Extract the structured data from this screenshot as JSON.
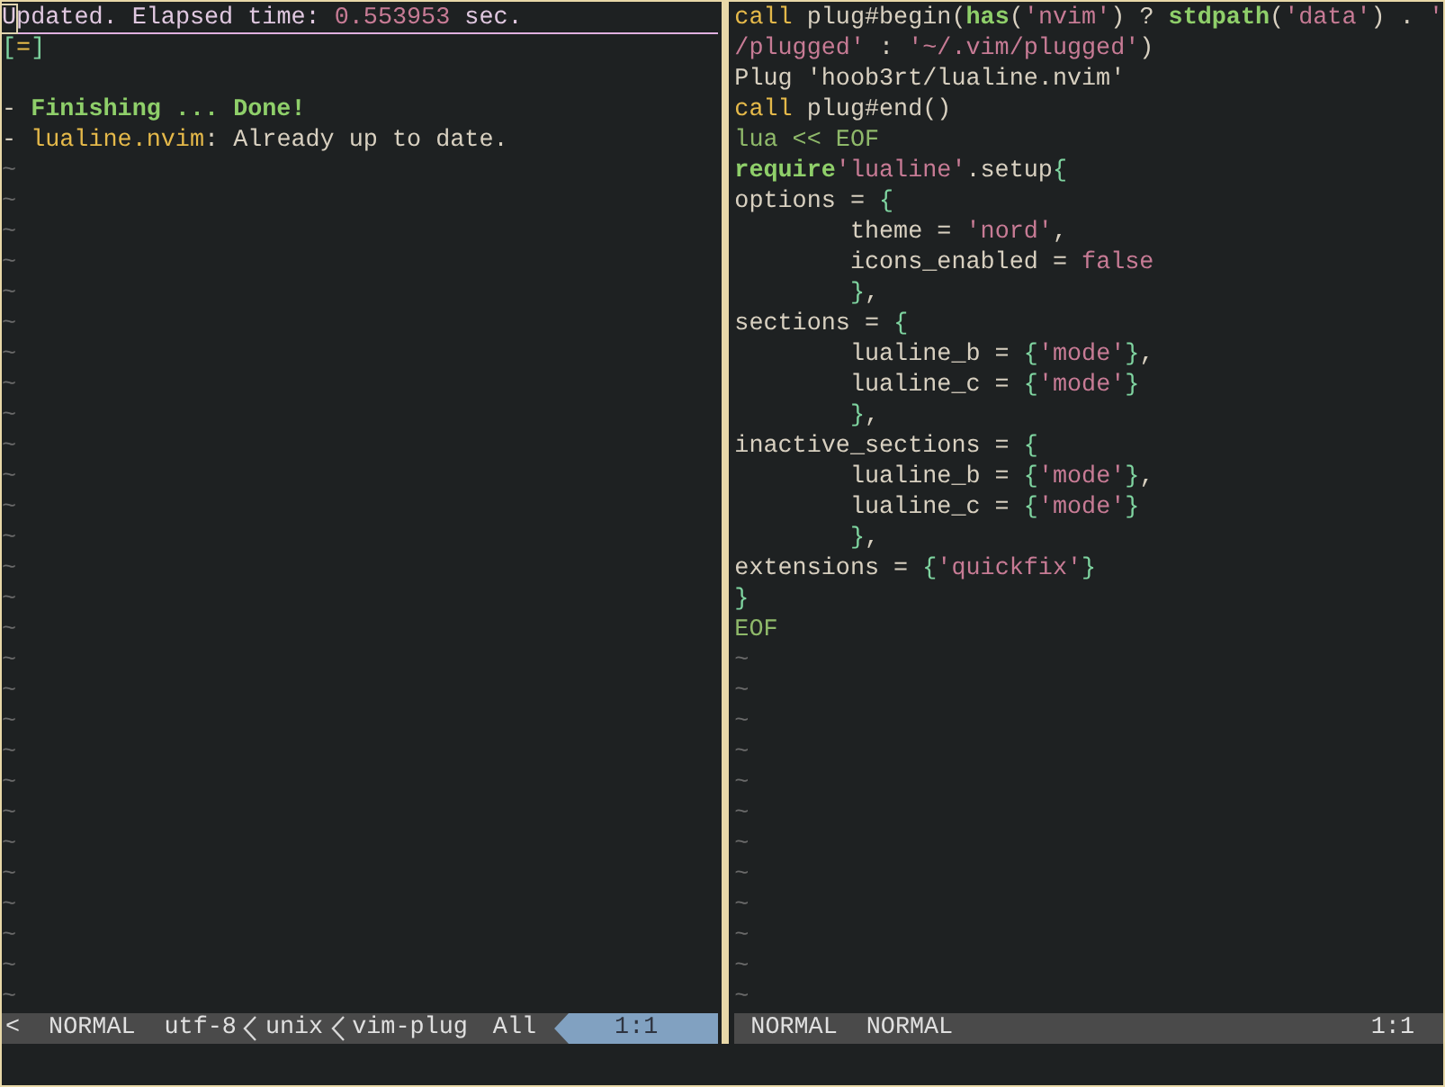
{
  "left_pane": {
    "lines": [
      {
        "tokens": [
          {
            "kind": "cursor",
            "text": "U"
          },
          {
            "kind": "message",
            "text": "pdated. Elapsed time: "
          },
          {
            "kind": "number",
            "text": "0.553953"
          },
          {
            "kind": "message",
            "text": " sec."
          }
        ]
      },
      {
        "tokens": [
          {
            "kind": "brace",
            "text": "["
          },
          {
            "kind": "keyword",
            "text": "="
          },
          {
            "kind": "brace",
            "text": "]"
          }
        ]
      },
      {
        "blank": true
      },
      {
        "tokens": [
          {
            "kind": "text",
            "text": "- "
          },
          {
            "kind": "success",
            "text": "Finishing ... Done!"
          }
        ]
      },
      {
        "tokens": [
          {
            "kind": "text",
            "text": "- "
          },
          {
            "kind": "keyword",
            "text": "lualine.nvim"
          },
          {
            "kind": "text",
            "text": ": Already up to date."
          }
        ]
      }
    ],
    "tildes": [
      "~",
      "~",
      "~",
      "~",
      "~",
      "~",
      "~",
      "~",
      "~",
      "~",
      "~",
      "~",
      "~",
      "~",
      "~",
      "~",
      "~",
      "~",
      "~",
      "~",
      "~",
      "~",
      "~",
      "~",
      "~",
      "~",
      "~",
      "~"
    ]
  },
  "right_pane": {
    "lines": [
      {
        "tokens": [
          {
            "kind": "keyword",
            "text": "call"
          },
          {
            "kind": "text",
            "text": " plug#begin("
          },
          {
            "kind": "function",
            "text": "has"
          },
          {
            "kind": "text",
            "text": "("
          },
          {
            "kind": "string",
            "text": "'nvim'"
          },
          {
            "kind": "text",
            "text": ") ? "
          },
          {
            "kind": "function",
            "text": "stdpath"
          },
          {
            "kind": "text",
            "text": "("
          },
          {
            "kind": "string",
            "text": "'data'"
          },
          {
            "kind": "text",
            "text": ") . "
          },
          {
            "kind": "string",
            "text": "'"
          }
        ]
      },
      {
        "tokens": [
          {
            "kind": "string",
            "text": "/plugged'"
          },
          {
            "kind": "text",
            "text": " : "
          },
          {
            "kind": "string",
            "text": "'~/.vim/plugged'"
          },
          {
            "kind": "text",
            "text": ")"
          }
        ]
      },
      {
        "tokens": [
          {
            "kind": "text",
            "text": "Plug 'hoob3rt/lualine.nvim'"
          }
        ]
      },
      {
        "tokens": [
          {
            "kind": "keyword",
            "text": "call"
          },
          {
            "kind": "text",
            "text": " plug#end()"
          }
        ]
      },
      {
        "tokens": [
          {
            "kind": "heredoc",
            "text": "lua << EOF"
          }
        ]
      },
      {
        "tokens": [
          {
            "kind": "function",
            "text": "require"
          },
          {
            "kind": "string",
            "text": "'lualine'"
          },
          {
            "kind": "text",
            "text": ".setup"
          },
          {
            "kind": "brace",
            "text": "{"
          }
        ]
      },
      {
        "tokens": [
          {
            "kind": "text",
            "text": "options = "
          },
          {
            "kind": "brace",
            "text": "{"
          }
        ]
      },
      {
        "indented": true,
        "tokens": [
          {
            "kind": "text",
            "text": "theme = "
          },
          {
            "kind": "string",
            "text": "'nord'"
          },
          {
            "kind": "text",
            "text": ","
          }
        ]
      },
      {
        "indented": true,
        "tokens": [
          {
            "kind": "text",
            "text": "icons_enabled = "
          },
          {
            "kind": "string",
            "text": "false"
          }
        ]
      },
      {
        "indented": true,
        "tokens": [
          {
            "kind": "brace",
            "text": "}"
          },
          {
            "kind": "text",
            "text": ","
          }
        ]
      },
      {
        "tokens": [
          {
            "kind": "text",
            "text": "sections = "
          },
          {
            "kind": "brace",
            "text": "{"
          }
        ]
      },
      {
        "indented": true,
        "tokens": [
          {
            "kind": "text",
            "text": "lualine_b = "
          },
          {
            "kind": "brace",
            "text": "{"
          },
          {
            "kind": "string",
            "text": "'mode'"
          },
          {
            "kind": "brace",
            "text": "}"
          },
          {
            "kind": "text",
            "text": ","
          }
        ]
      },
      {
        "indented": true,
        "tokens": [
          {
            "kind": "text",
            "text": "lualine_c = "
          },
          {
            "kind": "brace",
            "text": "{"
          },
          {
            "kind": "string",
            "text": "'mode'"
          },
          {
            "kind": "brace",
            "text": "}"
          }
        ]
      },
      {
        "indented": true,
        "tokens": [
          {
            "kind": "brace",
            "text": "}"
          },
          {
            "kind": "text",
            "text": ","
          }
        ]
      },
      {
        "tokens": [
          {
            "kind": "text",
            "text": "inactive_sections = "
          },
          {
            "kind": "brace",
            "text": "{"
          }
        ]
      },
      {
        "indented": true,
        "tokens": [
          {
            "kind": "text",
            "text": "lualine_b = "
          },
          {
            "kind": "brace",
            "text": "{"
          },
          {
            "kind": "string",
            "text": "'mode'"
          },
          {
            "kind": "brace",
            "text": "}"
          },
          {
            "kind": "text",
            "text": ","
          }
        ]
      },
      {
        "indented": true,
        "tokens": [
          {
            "kind": "text",
            "text": "lualine_c = "
          },
          {
            "kind": "brace",
            "text": "{"
          },
          {
            "kind": "string",
            "text": "'mode'"
          },
          {
            "kind": "brace",
            "text": "}"
          }
        ]
      },
      {
        "indented": true,
        "tokens": [
          {
            "kind": "brace",
            "text": "}"
          },
          {
            "kind": "text",
            "text": ","
          }
        ]
      },
      {
        "tokens": [
          {
            "kind": "text",
            "text": "extensions = "
          },
          {
            "kind": "brace",
            "text": "{"
          },
          {
            "kind": "string",
            "text": "'quickfix'"
          },
          {
            "kind": "brace",
            "text": "}"
          }
        ]
      },
      {
        "tokens": [
          {
            "kind": "brace",
            "text": "}"
          }
        ]
      },
      {
        "tokens": [
          {
            "kind": "heredoc",
            "text": "EOF"
          }
        ]
      }
    ],
    "tildes": [
      "~",
      "~",
      "~",
      "~",
      "~",
      "~",
      "~",
      "~",
      "~",
      "~",
      "~",
      "~"
    ]
  },
  "left_statusline": {
    "truncation": "<",
    "mode": "NORMAL",
    "encoding": "utf-8",
    "fileformat": "unix",
    "filetype": "vim-plug",
    "progress": "All",
    "location": "1:1"
  },
  "right_statusline": {
    "mode": "NORMAL",
    "section_b": "NORMAL",
    "location": "1:1"
  }
}
